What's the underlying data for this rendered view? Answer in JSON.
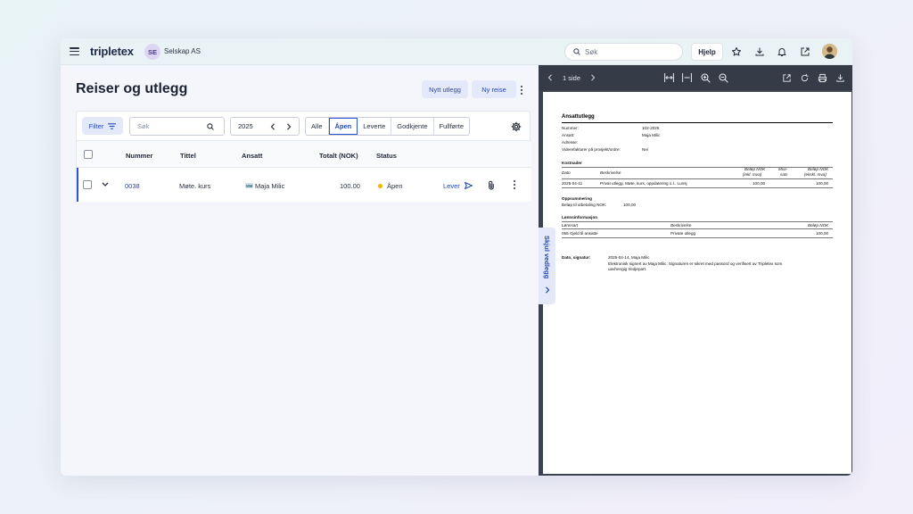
{
  "app": {
    "logo": "tripletex",
    "company_initials": "SE",
    "company_name": "Selskap AS",
    "search_placeholder": "Søk",
    "help_label": "Hjelp"
  },
  "page": {
    "title": "Reiser og utlegg",
    "new_expense_label": "Nytt utlegg",
    "new_trip_label": "Ny reise"
  },
  "filterbar": {
    "filter_label": "Filter",
    "search_placeholder": "Søk",
    "year": "2025",
    "segments": [
      "Alle",
      "Åpen",
      "Leverte",
      "Godkjente",
      "Fullførte"
    ],
    "active_segment": "Åpen"
  },
  "table": {
    "columns": [
      "Nummer",
      "Tittel",
      "Ansatt",
      "Totalt (NOK)",
      "Status"
    ],
    "rows": [
      {
        "number": "0038",
        "title": "Møte. kurs",
        "employee_initials": "MM",
        "employee": "Maja Milic",
        "total": "100.00",
        "status": "Åpen",
        "deliver_label": "Lever"
      }
    ]
  },
  "preview": {
    "page_label": "1 side",
    "side_tab_label": "Skjul vedlegg",
    "document": {
      "title": "Ansattutlegg",
      "info": [
        {
          "label": "Nummer:",
          "value": "102-2025"
        },
        {
          "label": "Ansatt:",
          "value": "Maja Milic"
        },
        {
          "label": "Adresse:",
          "value": ""
        },
        {
          "label": "Viderefakturer på prosjekt/ordre:",
          "value": "Nei"
        }
      ],
      "costs_heading": "Kostnader",
      "costs_columns": [
        "Dato",
        "Beskrivelse",
        "Beløp NOK",
        "(inkl. mva)",
        "Mva-",
        "sats",
        "Beløp NOK",
        "(ekskl. mva)"
      ],
      "costs_row": {
        "date": "2025-04-11",
        "description": "Privat utlegg. Møte, kurs, oppdatering o.l.. Lunsj",
        "incl": "100,00",
        "excl": "100,00"
      },
      "summary_heading": "Oppsummering",
      "summary_text": "Beløp til utbetaling NOK:",
      "summary_value": "100,00",
      "salary_heading": "Lønnsinformasjon",
      "salary_columns": [
        "Lønnsart",
        "Beskrivelse",
        "Beløp NOK"
      ],
      "salary_row": {
        "type": "055 Gjeld til ansatte",
        "description": "Private utlegg",
        "amount": "100,00"
      },
      "signature_label": "Dato, signatur:",
      "signature_date": "2025-04-14, Maja Milic",
      "signature_line1": "Elektronisk signert av Maja Milic. Signaturen er sikret med passord og verifisert av Tripletex som",
      "signature_line2": "uavhengig tredjepart."
    }
  },
  "colors": {
    "accent": "#2f55d4",
    "status_open": "#f4b400",
    "viewer_toolbar": "#353b47"
  }
}
